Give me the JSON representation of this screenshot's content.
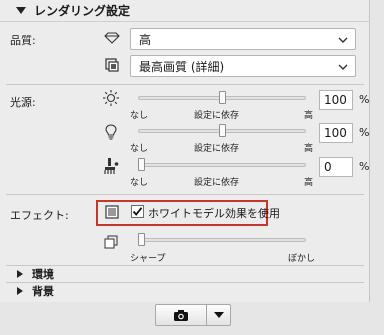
{
  "rendering": {
    "header": "レンダリング設定",
    "quality_label": "品質:",
    "quality_value": "高",
    "detail_value": "最高画質 (詳細)"
  },
  "lights": {
    "label": "光源:",
    "sliders": [
      {
        "icon": "sun-icon",
        "value": "100",
        "unit": "%",
        "level": 0.5,
        "left": "なし",
        "mid": "設定に依存",
        "right": "高"
      },
      {
        "icon": "bulb-icon",
        "value": "100",
        "unit": "%",
        "level": 0.5,
        "left": "なし",
        "mid": "設定に依存",
        "right": "高"
      },
      {
        "icon": "brush-icon",
        "value": "0",
        "unit": "%",
        "level": 0.0,
        "left": "なし",
        "mid": "設定に依存",
        "right": "高"
      }
    ]
  },
  "effect": {
    "label": "エフェクト:",
    "checkbox_label": "ホワイトモデル効果を使用",
    "checked": true,
    "blur_left": "シャープ",
    "blur_right": "ぼかし",
    "blur_level": 0.0
  },
  "sections": {
    "environment": "環境",
    "background": "背景"
  },
  "colors": {
    "highlight": "#c0392b",
    "panel": "#ececec"
  }
}
